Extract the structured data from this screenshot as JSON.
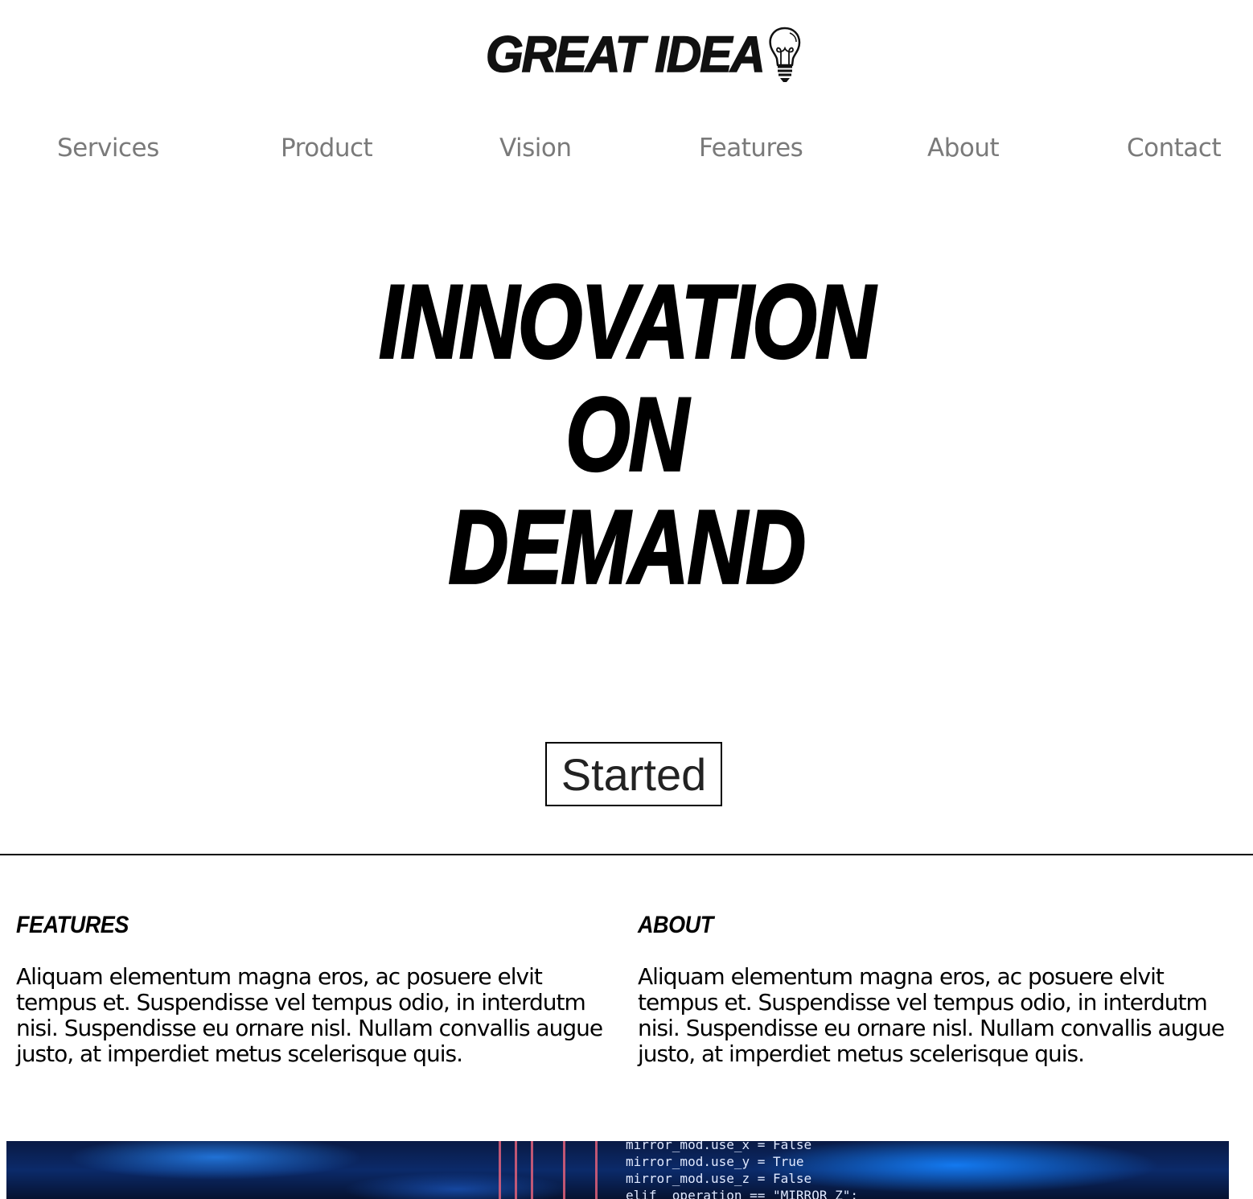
{
  "logo": {
    "text": "GREAT IDEA",
    "icon": "lightbulb-icon"
  },
  "nav": {
    "items": [
      {
        "label": "Services"
      },
      {
        "label": "Product"
      },
      {
        "label": "Vision"
      },
      {
        "label": "Features"
      },
      {
        "label": "About"
      },
      {
        "label": "Contact"
      }
    ]
  },
  "hero": {
    "lines": [
      "INNOVATION",
      "ON",
      "DEMAND"
    ]
  },
  "cta": {
    "label": "Started"
  },
  "features": {
    "heading": "FEATURES",
    "body": "Aliquam elementum magna eros, ac posuere elvit tempus et. Suspendisse vel tempus odio, in interdutm nisi. Suspendisse eu ornare nisl. Nullam convallis augue justo, at imperdiet metus scelerisque quis."
  },
  "about": {
    "heading": "ABOUT",
    "body": "Aliquam elementum magna eros, ac posuere elvit tempus et. Suspendisse vel tempus odio, in interdutm nisi. Suspendisse eu ornare nisl. Nullam convallis augue justo, at imperdiet metus scelerisque quis."
  },
  "code_banner": {
    "lines": [
      "mirror_mod.use_x = False",
      "mirror_mod.use_y = True",
      "mirror_mod.use_z = False",
      "elif _operation == \"MIRROR_Z\":"
    ],
    "colors": {
      "background": "#0b2a6a",
      "glow": "#1e82ff",
      "stripe": "#e0607a"
    }
  }
}
